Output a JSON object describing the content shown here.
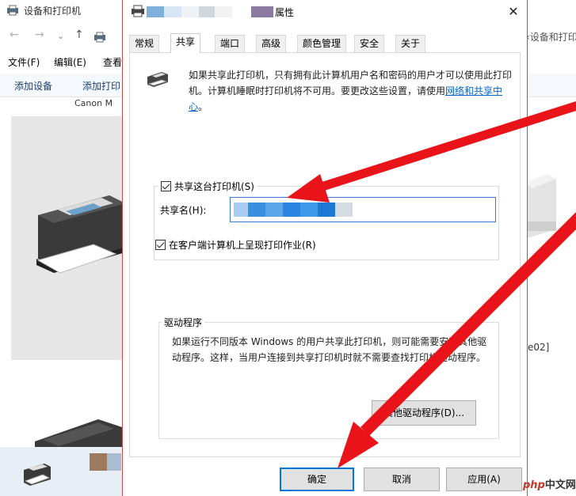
{
  "background_window": {
    "title": "设备和打印机",
    "breadcrumb_right": "‹设备和打印机",
    "menu": [
      "文件(F)",
      "编辑(E)",
      "查看"
    ],
    "toolbar": [
      "添加设备",
      "添加打印"
    ],
    "device_label": "Canon M",
    "right_label": "e02]"
  },
  "dialog": {
    "title_suffix": "属性",
    "tabs": [
      "常规",
      "共享",
      "端口",
      "高级",
      "颜色管理",
      "安全",
      "关于"
    ],
    "active_tab": "共享",
    "info_text_before_link": "如果共享此打印机，只有拥有此计算机用户名和密码的用户才可以使用此打印机。计算机睡眠时打印机将不可用。要更改这些设置，请使用",
    "info_link": "网络和共享中心",
    "info_text_after_link": "。",
    "share_checkbox_label": "共享这台打印机(S)",
    "share_name_label": "共享名(H):",
    "render_jobs_label": "在客户端计算机上呈现打印作业(R)",
    "drivers_legend": "驱动程序",
    "drivers_text": "如果运行不同版本 Windows 的用户共享此打印机，则可能需要安装其他驱动程序。这样，当用户连接到共享打印机时就不需要查找打印机驱动程序。",
    "other_drivers_button": "其他驱动程序(D)...",
    "ok_button": "确定",
    "cancel_button": "取消",
    "apply_button": "应用(A)"
  },
  "watermark": {
    "php": "php",
    "rest": "中文网"
  },
  "colors": {
    "accent": "#0078d7",
    "link": "#0066cc",
    "arrow": "#e8141a",
    "blur_blue": "#3d9ae8"
  }
}
